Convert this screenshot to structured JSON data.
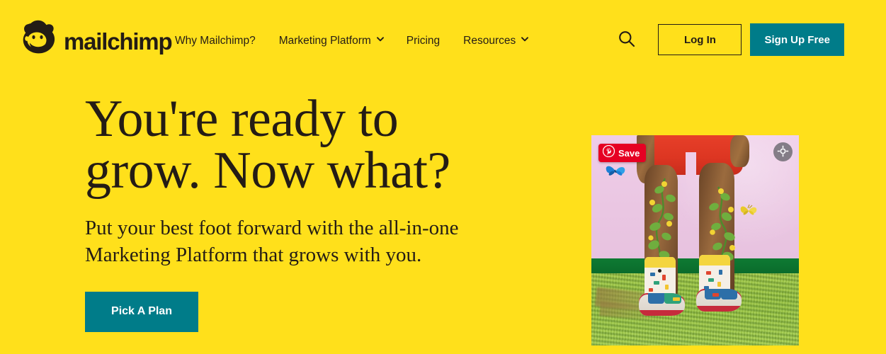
{
  "theme": {
    "background": "#FFE01B",
    "ink": "#241C15",
    "teal": "#007C89",
    "pinterest_red": "#E60023",
    "white": "#FFFFFF"
  },
  "header": {
    "logo": {
      "icon": "mailchimp-freddie-icon",
      "wordmark": "mailchimp"
    },
    "nav": [
      {
        "label": "Why Mailchimp?",
        "has_dropdown": false
      },
      {
        "label": "Marketing Platform",
        "has_dropdown": true
      },
      {
        "label": "Pricing",
        "has_dropdown": false
      },
      {
        "label": "Resources",
        "has_dropdown": true
      }
    ],
    "search_icon": "search-icon",
    "login_label": "Log In",
    "signup_label": "Sign Up Free"
  },
  "hero": {
    "title_line1": "You're ready to",
    "title_line2": "grow. Now what?",
    "subtitle_line1": "Put your best foot forward with the all-in-one",
    "subtitle_line2": "Marketing Platform that grows with you.",
    "cta_label": "Pick A Plan"
  },
  "photo": {
    "alt": "Person in red shorts standing on grass with vines growing up their legs, patterned socks and sandals",
    "save_badge": {
      "icon": "pinterest-icon",
      "label": "Save"
    },
    "expand_icon": "expand-crosshair-icon"
  }
}
